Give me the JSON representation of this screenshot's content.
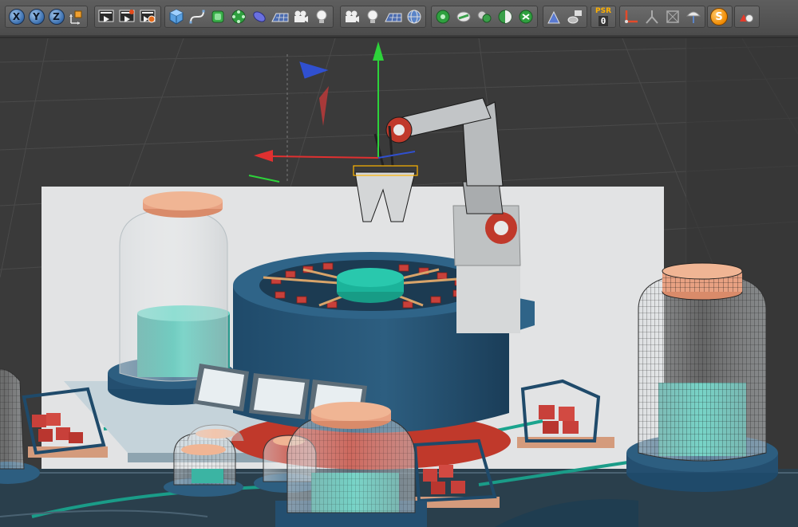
{
  "app": {
    "window_title": "",
    "accent": "#f08a00"
  },
  "toolbar": {
    "axis_lock": [
      {
        "label": "X",
        "icon": "x-axis-lock-icon"
      },
      {
        "label": "Y",
        "icon": "y-axis-lock-icon"
      },
      {
        "label": "Z",
        "icon": "z-axis-lock-icon"
      }
    ],
    "coordinate_system_icon": "world-coordinate-system-icon",
    "render_icons": [
      "render-view-icon",
      "render-to-picture-viewer-icon",
      "edit-render-settings-icon"
    ],
    "object_icons": [
      "cube-primitive-icon",
      "spline-pen-icon",
      "subdivision-surface-icon",
      "cloner-icon",
      "deformer-icon",
      "floor-icon",
      "camera-icon",
      "light-icon"
    ],
    "scene_icons": [
      "camera-icon",
      "light-icon",
      "floor-icon",
      "sky-icon"
    ],
    "mograph_icons": [
      "mograph-cloner-icon",
      "fracture-icon",
      "matrix-icon",
      "shader-effector-icon",
      "random-effector-icon"
    ],
    "tools_icons": [
      "sculpt-icon",
      "mesh-check-icon"
    ],
    "psr": {
      "label": "PSR",
      "value": "0"
    },
    "misc_icons": [
      "joint-icon",
      "ik-chain-icon",
      "skin-icon",
      "cloth-icon"
    ],
    "snap_label": "S",
    "last_icon": "materials-icon"
  },
  "viewport": {
    "background_color": "#3a3a3a",
    "grid_color": "#4a4a4a",
    "axis_colors": {
      "x": "#e03030",
      "y": "#2dd23a",
      "z": "#3050d0"
    }
  }
}
